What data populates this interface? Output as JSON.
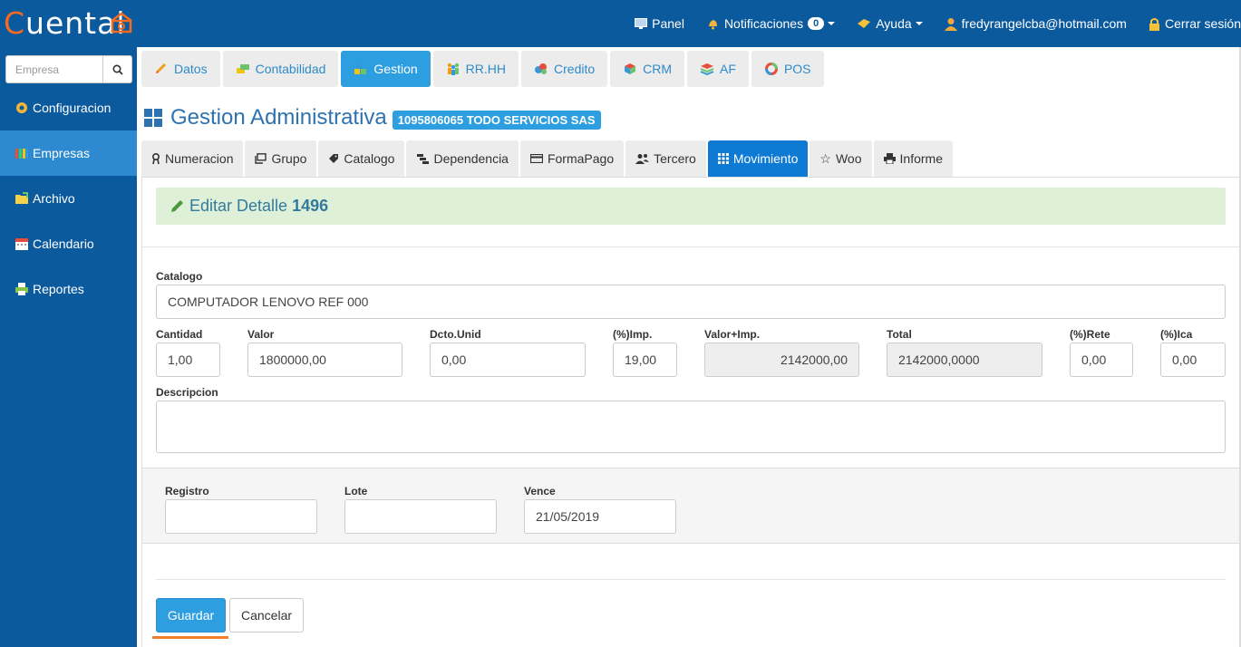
{
  "brand": {
    "first_letter": "C",
    "rest": "uental"
  },
  "navbar": {
    "panel": "Panel",
    "notifications": "Notificaciones",
    "notifications_count": "0",
    "help": "Ayuda",
    "user_email": "fredyrangelcba@hotmail.com",
    "logout": "Cerrar sesión"
  },
  "sidebar": {
    "search_placeholder": "Empresa",
    "items": [
      {
        "label": "Configuracion",
        "icon": "gear-icon"
      },
      {
        "label": "Empresas",
        "icon": "books-icon",
        "active": true
      },
      {
        "label": "Archivo",
        "icon": "folder-icon"
      },
      {
        "label": "Calendario",
        "icon": "calendar-icon"
      },
      {
        "label": "Reportes",
        "icon": "printer-icon"
      }
    ]
  },
  "module_tabs": [
    {
      "label": "Datos",
      "icon": "pencil-icon"
    },
    {
      "label": "Contabilidad",
      "icon": "cash-icon"
    },
    {
      "label": "Gestion",
      "icon": "blocks-icon",
      "active": true
    },
    {
      "label": "RR.HH",
      "icon": "people-icon"
    },
    {
      "label": "Credito",
      "icon": "coins-icon"
    },
    {
      "label": "CRM",
      "icon": "cube-icon"
    },
    {
      "label": "AF",
      "icon": "layers-icon"
    },
    {
      "label": "POS",
      "icon": "ring-icon"
    }
  ],
  "page": {
    "title": "Gestion Administrativa",
    "company_label": "1095806065 TODO SERVICIOS SAS"
  },
  "sub_tabs": [
    {
      "label": "Numeracion",
      "icon": "ribbon-icon"
    },
    {
      "label": "Grupo",
      "icon": "copy-icon"
    },
    {
      "label": "Catalogo",
      "icon": "tag-icon"
    },
    {
      "label": "Dependencia",
      "icon": "sitemap-icon"
    },
    {
      "label": "FormaPago",
      "icon": "credit-card-icon"
    },
    {
      "label": "Tercero",
      "icon": "users-icon"
    },
    {
      "label": "Movimiento",
      "icon": "grid-icon",
      "active": true
    },
    {
      "label": "Woo",
      "icon": "star-icon"
    },
    {
      "label": "Informe",
      "icon": "print-icon"
    }
  ],
  "form": {
    "heading": "Editar Detalle",
    "record_id": "1496",
    "catalogo_label": "Catalogo",
    "catalogo_value": "COMPUTADOR LENOVO REF 000",
    "cantidad_label": "Cantidad",
    "cantidad_value": "1,00",
    "valor_label": "Valor",
    "valor_value": "1800000,00",
    "dcto_label": "Dcto.Unid",
    "dcto_value": "0,00",
    "imp_label": "(%)Imp.",
    "imp_value": "19,00",
    "valor_imp_label": "Valor+Imp.",
    "valor_imp_value": "2142000,00",
    "total_label": "Total",
    "total_value": "2142000,0000",
    "rete_label": "(%)Rete",
    "rete_value": "0,00",
    "ica_label": "(%)Ica",
    "ica_value": "0,00",
    "descripcion_label": "Descripcion",
    "descripcion_value": "",
    "registro_label": "Registro",
    "registro_value": "",
    "lote_label": "Lote",
    "lote_value": "",
    "vence_label": "Vence",
    "vence_value": "21/05/2019",
    "save_label": "Guardar",
    "cancel_label": "Cancelar"
  },
  "colors": {
    "navbar": "#0b5a9e",
    "accent": "#2d9ee0",
    "brand_orange": "#f36b21",
    "success_bg": "#dff0d8"
  }
}
